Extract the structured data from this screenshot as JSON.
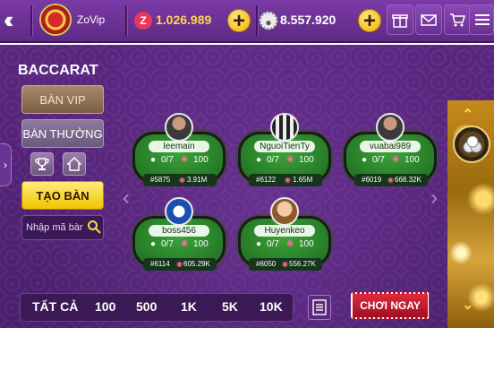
{
  "topbar": {
    "username": "ZoVip",
    "gold_amount": "1.026.989",
    "silver_amount": "8.557.920",
    "colors": {
      "gold": "#ffd84a",
      "silver": "#ffffff",
      "bar": "#6a3192"
    }
  },
  "left_panel": {
    "title": "BACCARAT",
    "ban_vip": "BÀN VIP",
    "ban_thuong": "BÀN THƯỜNG",
    "tao_ban": "TẠO BÀN",
    "room_code_placeholder": "Nhập mã bàn"
  },
  "tables": [
    {
      "name": "leemain",
      "players": "0/7",
      "bet": "100",
      "id": "#5875",
      "pot": "3.91M"
    },
    {
      "name": "NguoiTienTy",
      "players": "0/7",
      "bet": "100",
      "id": "#6122",
      "pot": "1.65M"
    },
    {
      "name": "vuabai989",
      "players": "0/7",
      "bet": "100",
      "id": "#6019",
      "pot": "668.32K"
    },
    {
      "name": "boss456",
      "players": "0/7",
      "bet": "100",
      "id": "#6114",
      "pot": "605.29K"
    },
    {
      "name": "Huyenkeo",
      "players": "0/7",
      "bet": "100",
      "id": "#6050",
      "pot": "556.27K"
    }
  ],
  "filters": [
    "TẤT CẢ",
    "100",
    "500",
    "1K",
    "5K",
    "10K"
  ],
  "play_now": "CHƠI NGAY",
  "icons": [
    "back-icon",
    "gold-coin-icon",
    "silver-coin-icon",
    "plus-icon",
    "gift-icon",
    "mail-icon",
    "shop-cart-icon",
    "menu-icon",
    "trophy-icon",
    "home-icon",
    "search-icon",
    "user-icon",
    "chip-icon",
    "money-bag-icon",
    "list-icon",
    "chevron-up-icon",
    "chevron-down-icon",
    "chips-icon"
  ]
}
